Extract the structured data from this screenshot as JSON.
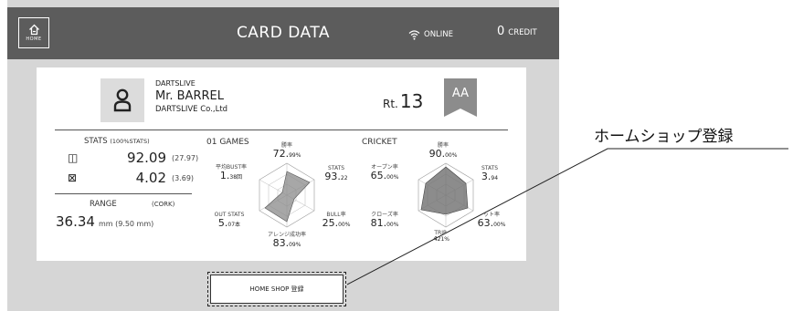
{
  "header": {
    "home_label": "HOME",
    "title": "CARD DATA",
    "online_label": "ONLINE",
    "credit_value": "0",
    "credit_label": "CREDIT"
  },
  "player": {
    "club": "DARTSLIVE",
    "name": "Mr. BARREL",
    "shop": "DARTSLIVE Co.,Ltd",
    "rating_prefix": "Rt.",
    "rating_value": "13",
    "class": "AA"
  },
  "stats": {
    "header": "STATS",
    "header_note": "(100%STATS)",
    "game01_icon": "◫",
    "game01_value": "92.09",
    "game01_sub": "(27.97)",
    "cricket_icon": "⊠",
    "cricket_value": "4.02",
    "cricket_sub": "(3.69)",
    "range_header": "RANGE",
    "range_note": "(CORK)",
    "range_value": "36.34",
    "range_unit": "mm (9.50 mm)"
  },
  "games01": {
    "title": "01 GAMES",
    "win_label": "勝率",
    "win_value": "72.",
    "win_unit": "99%",
    "stats_label": "STATS",
    "stats_value": "93.",
    "stats_unit": "22",
    "bull_label": "BULL率",
    "bull_value": "25.",
    "bull_unit": "00%",
    "arrange_label": "アレンジ成功率",
    "arrange_value": "83.",
    "arrange_unit": "09%",
    "out_label": "OUT STATS",
    "out_value": "5.",
    "out_unit": "07本",
    "bust_label": "平均BUST率",
    "bust_value": "1.",
    "bust_unit": "38回"
  },
  "cricket": {
    "title": "CRICKET",
    "win_label": "勝率",
    "win_value": "90.",
    "win_unit": "00%",
    "stats_label": "STATS",
    "stats_value": "3.",
    "stats_unit": "94",
    "hit_label": "ット率",
    "hit_value": "63.",
    "hit_unit": "00%",
    "triple_label": "TRIP",
    "triple_value": ".4",
    "triple_unit": "21%",
    "close_label": "クローズ率",
    "close_value": "81.",
    "close_unit": "00%",
    "open_label": "オープン率",
    "open_value": "65.",
    "open_unit": "00%"
  },
  "home_shop_button": "HOME SHOP 登録",
  "callout": "ホームショップ登録"
}
